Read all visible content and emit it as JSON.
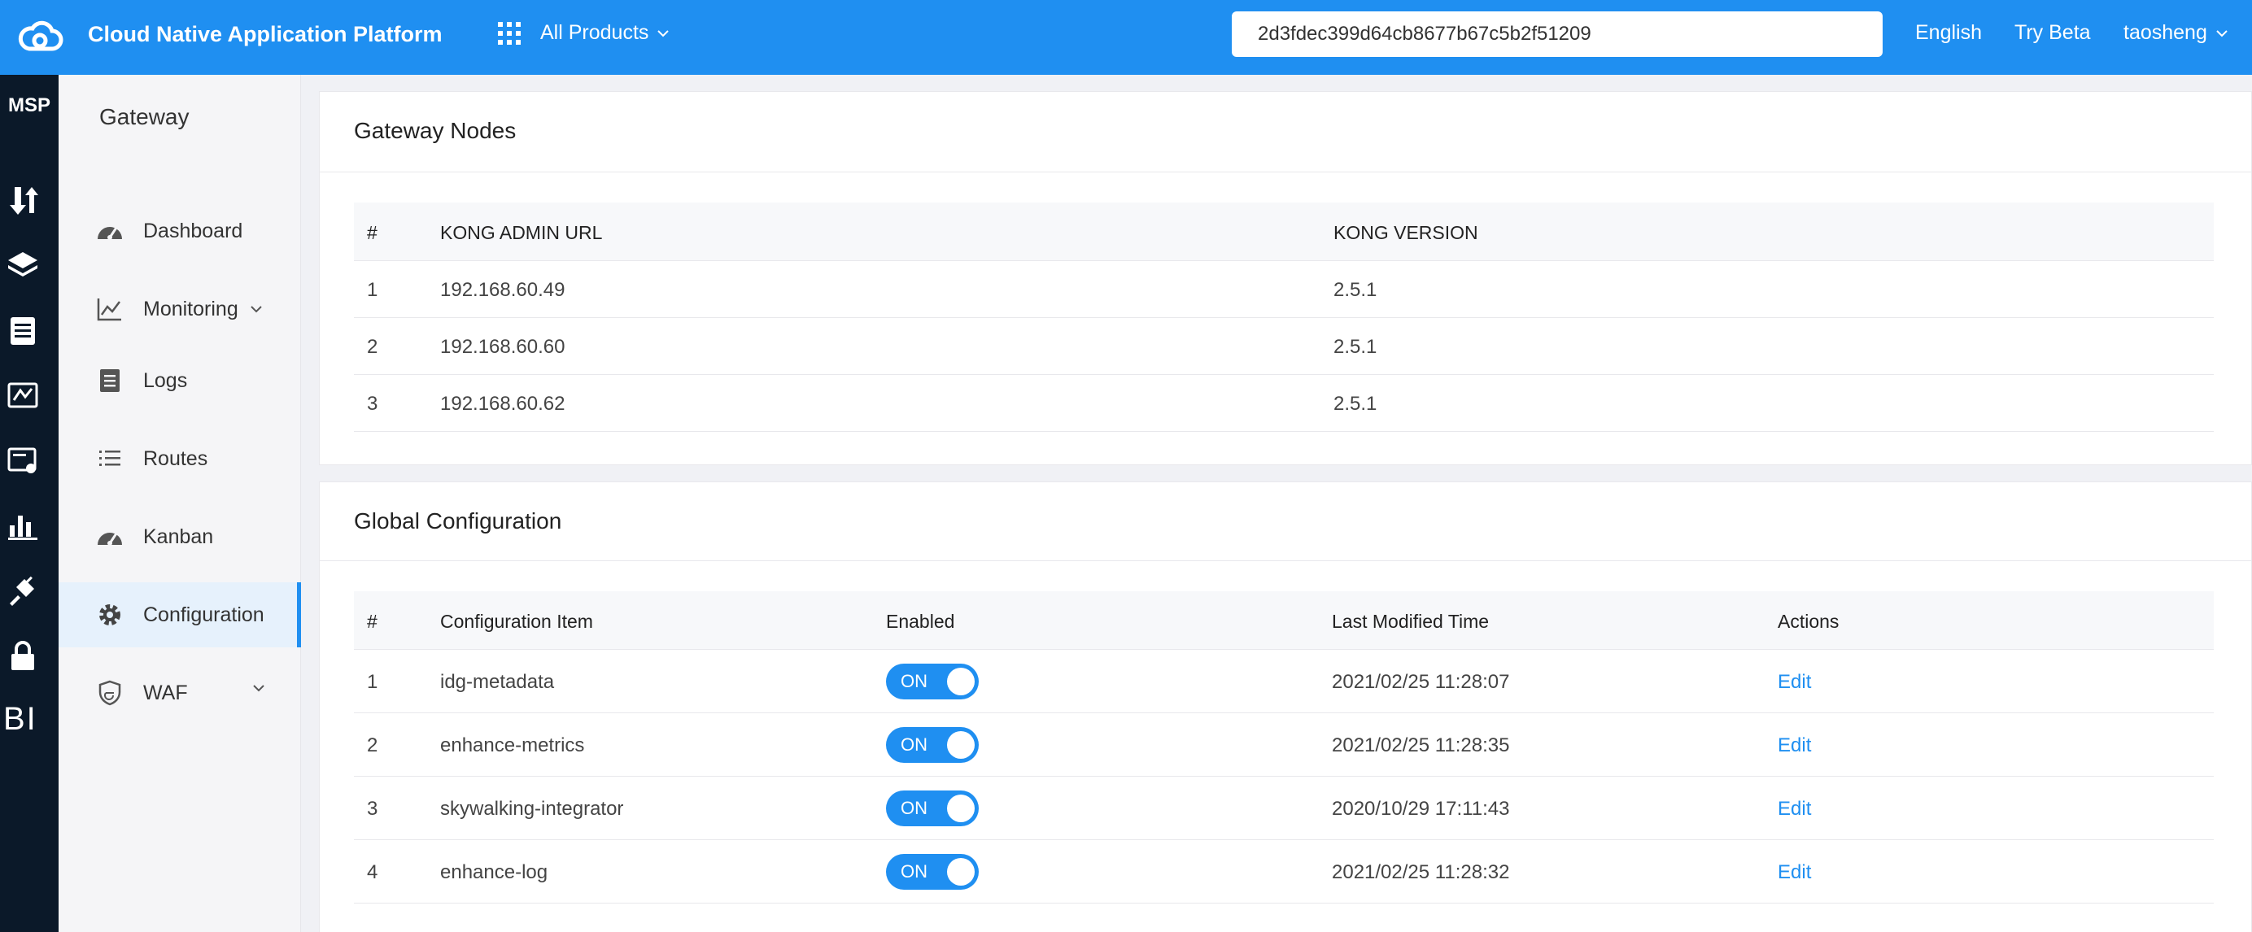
{
  "header": {
    "title": "Cloud Native Application Platform",
    "products_label": "All Products",
    "search_value": "2d3fdec399d64cb8677b67c5b2f51209",
    "language": "English",
    "try_beta": "Try Beta",
    "user": "taosheng"
  },
  "rail": {
    "label": "MSP",
    "bi_label": "BI",
    "icons": [
      "upload-download-icon",
      "layers-icon",
      "clipboard-icon",
      "monitor-icon",
      "certificate-icon",
      "bar-chart-icon",
      "plug-icon",
      "lock-icon"
    ]
  },
  "sidebar": {
    "title": "Gateway",
    "items": [
      {
        "label": "Dashboard",
        "icon": "dashboard-icon"
      },
      {
        "label": "Monitoring",
        "icon": "line-chart-icon",
        "expandable": true
      },
      {
        "label": "Logs",
        "icon": "logs-icon"
      },
      {
        "label": "Routes",
        "icon": "list-icon"
      },
      {
        "label": "Kanban",
        "icon": "kanban-icon"
      },
      {
        "label": "Configuration",
        "icon": "gear-icon",
        "active": true
      },
      {
        "label": "WAF",
        "icon": "shield-icon",
        "expandable": true
      }
    ]
  },
  "gateway_nodes": {
    "title": "Gateway Nodes",
    "columns": [
      "#",
      "KONG ADMIN URL",
      "KONG VERSION"
    ],
    "rows": [
      {
        "index": "1",
        "url": "192.168.60.49",
        "version": "2.5.1"
      },
      {
        "index": "2",
        "url": "192.168.60.60",
        "version": "2.5.1"
      },
      {
        "index": "3",
        "url": "192.168.60.62",
        "version": "2.5.1"
      }
    ]
  },
  "global_config": {
    "title": "Global Configuration",
    "columns": [
      "#",
      "Configuration Item",
      "Enabled",
      "Last Modified Time",
      "Actions"
    ],
    "rows": [
      {
        "index": "1",
        "item": "idg-metadata",
        "enabled": "ON",
        "modified": "2021/02/25 11:28:07",
        "action": "Edit"
      },
      {
        "index": "2",
        "item": "enhance-metrics",
        "enabled": "ON",
        "modified": "2021/02/25 11:28:35",
        "action": "Edit"
      },
      {
        "index": "3",
        "item": "skywalking-integrator",
        "enabled": "ON",
        "modified": "2020/10/29 17:11:43",
        "action": "Edit"
      },
      {
        "index": "4",
        "item": "enhance-log",
        "enabled": "ON",
        "modified": "2021/02/25 11:28:32",
        "action": "Edit"
      }
    ]
  },
  "colors": {
    "primary": "#1f8ff1",
    "rail": "#0b1929",
    "sidebar_bg": "#f5f5f7",
    "active_bg": "#e6f1fc"
  }
}
